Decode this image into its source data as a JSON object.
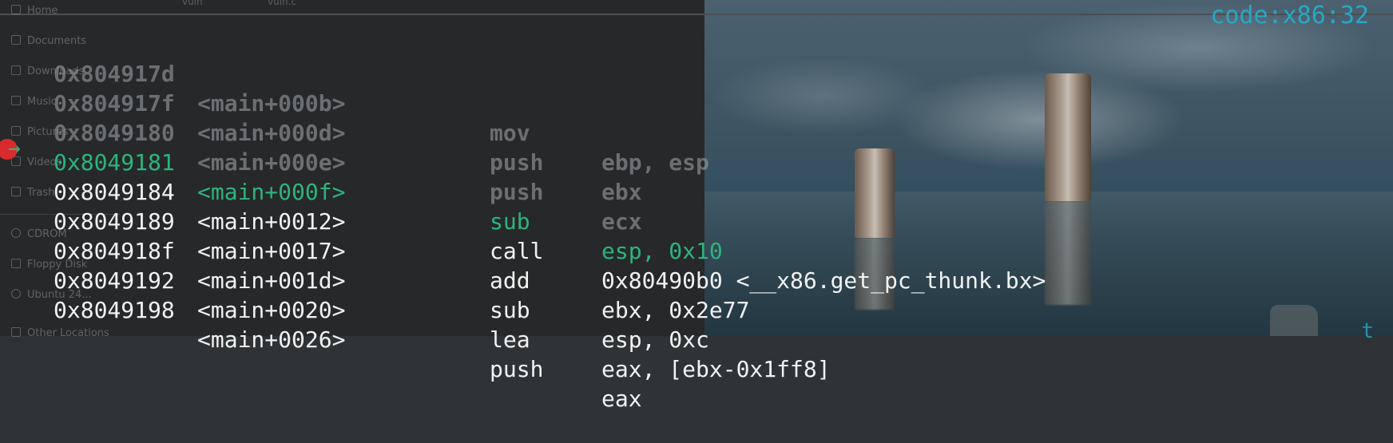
{
  "disassembly": {
    "rows": [
      {
        "address": "0x804917d",
        "symbol": "<main+000b>",
        "opcode": "mov",
        "operands": "ebp, esp",
        "state": "past"
      },
      {
        "address": "0x804917f",
        "symbol": "<main+000d>",
        "opcode": "push",
        "operands": "ebx",
        "state": "past"
      },
      {
        "address": "0x8049180",
        "symbol": "<main+000e>",
        "opcode": "push",
        "operands": "ecx",
        "state": "past"
      },
      {
        "address": "0x8049181",
        "symbol": "<main+000f>",
        "opcode": "sub",
        "operands": "esp, 0x10",
        "state": "current"
      },
      {
        "address": "0x8049184",
        "symbol": "<main+0012>",
        "opcode": "call",
        "operands": "0x80490b0 <__x86.get_pc_thunk.bx>",
        "state": "next"
      },
      {
        "address": "0x8049189",
        "symbol": "<main+0017>",
        "opcode": "add",
        "operands": "ebx, 0x2e77",
        "state": "next"
      },
      {
        "address": "0x804918f",
        "symbol": "<main+001d>",
        "opcode": "sub",
        "operands": "esp, 0xc",
        "state": "next"
      },
      {
        "address": "0x8049192",
        "symbol": "<main+0020>",
        "opcode": "lea",
        "operands": "eax, [ebx-0x1ff8]",
        "state": "next"
      },
      {
        "address": "0x8049198",
        "symbol": "<main+0026>",
        "opcode": "push",
        "operands": "eax",
        "state": "next"
      }
    ]
  },
  "arch_label": "code:x86:32",
  "pc_arrow": "→",
  "bottom_partial_text": "t",
  "ghost_sidebar": {
    "tabs": [
      "vuln",
      "vuln.c"
    ],
    "items": [
      {
        "label": "Home",
        "icon": "home-icon"
      },
      {
        "label": "Documents",
        "icon": "document-icon"
      },
      {
        "label": "Downloads",
        "icon": "download-icon"
      },
      {
        "label": "Music",
        "icon": "music-icon"
      },
      {
        "label": "Pictures",
        "icon": "picture-icon"
      },
      {
        "label": "Videos",
        "icon": "video-icon"
      },
      {
        "label": "Trash",
        "icon": "trash-icon"
      },
      {
        "label": "CDROM",
        "icon": "disc-icon"
      },
      {
        "label": "Floppy Disk",
        "icon": "floppy-icon"
      },
      {
        "label": "Ubuntu 24...",
        "icon": "disc-icon"
      },
      {
        "label": "Other Locations",
        "icon": "plus-icon"
      }
    ]
  },
  "colors": {
    "current_line": "#2bb57e",
    "arch_label": "#2aa7c4",
    "breakpoint": "#d92b2b",
    "text": "#f2f2f2"
  }
}
